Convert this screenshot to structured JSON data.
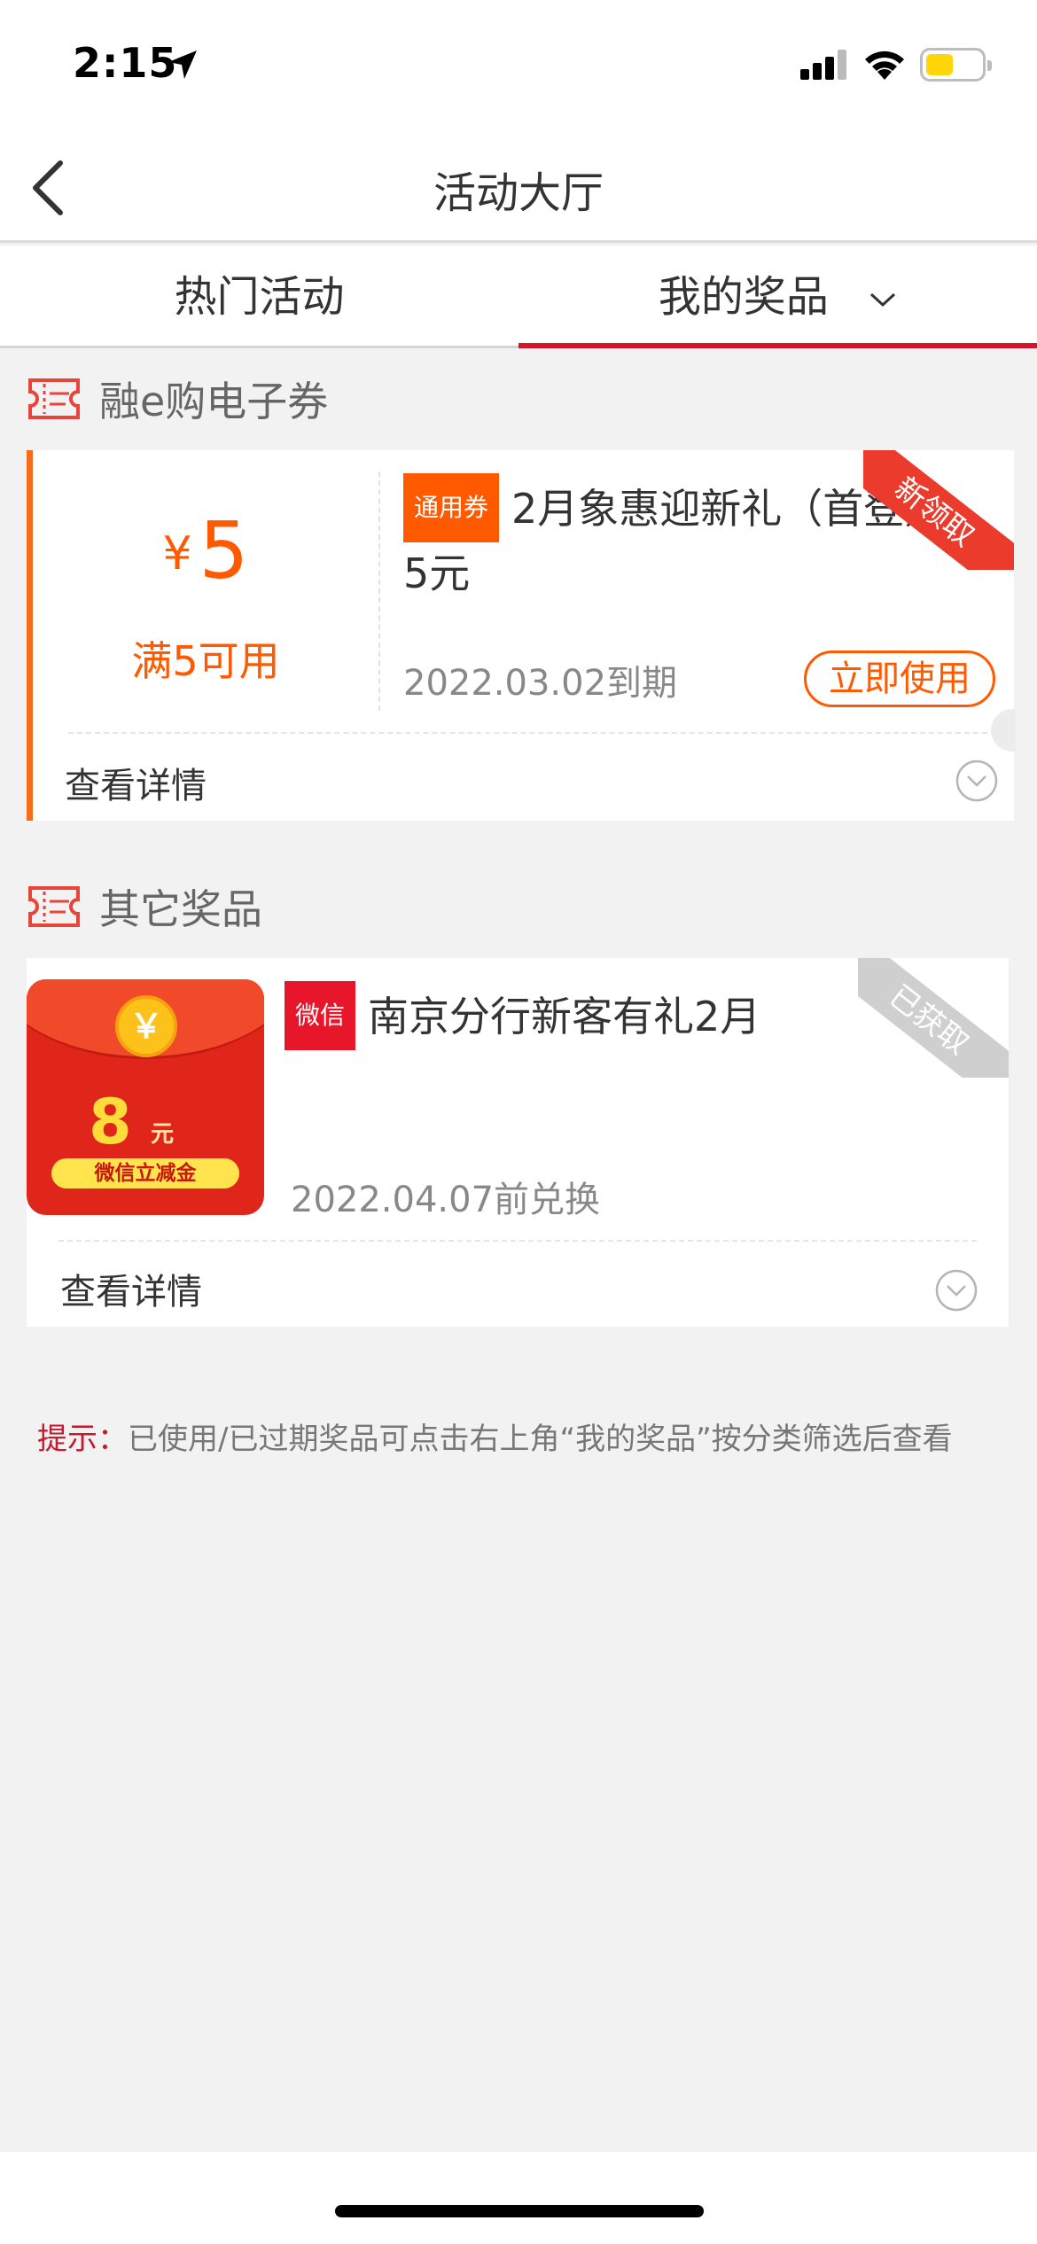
{
  "status_bar": {
    "time": "2:15"
  },
  "nav": {
    "title": "活动大厅"
  },
  "tabs": [
    {
      "label": "热门活动",
      "active": false
    },
    {
      "label": "我的奖品",
      "active": true
    }
  ],
  "section_ecoupon": {
    "title": "融e购电子券",
    "card": {
      "currency": "¥",
      "amount": "5",
      "condition": "满5可用",
      "badge": "通用券",
      "title": "2月象惠迎新礼（首登）5元",
      "expiry": "2022.03.02到期",
      "use_button": "立即使用",
      "corner_tag": "新领取",
      "details_label": "查看详情"
    }
  },
  "section_other": {
    "title": "其它奖品",
    "card": {
      "packet_symbol": "￥",
      "packet_amount": "8",
      "packet_unit": "元",
      "packet_label": "微信立减金",
      "badge": "微信",
      "title": "南京分行新客有礼2月",
      "expiry": "2022.04.07前兑换",
      "corner_tag": "已获取",
      "details_label": "查看详情"
    }
  },
  "tip": {
    "label": "提示：",
    "text": "已使用/已过期奖品可点击右上角“我的奖品”按分类筛选后查看"
  },
  "colors": {
    "accent_red": "#d7142b",
    "orange": "#ff5a00"
  }
}
